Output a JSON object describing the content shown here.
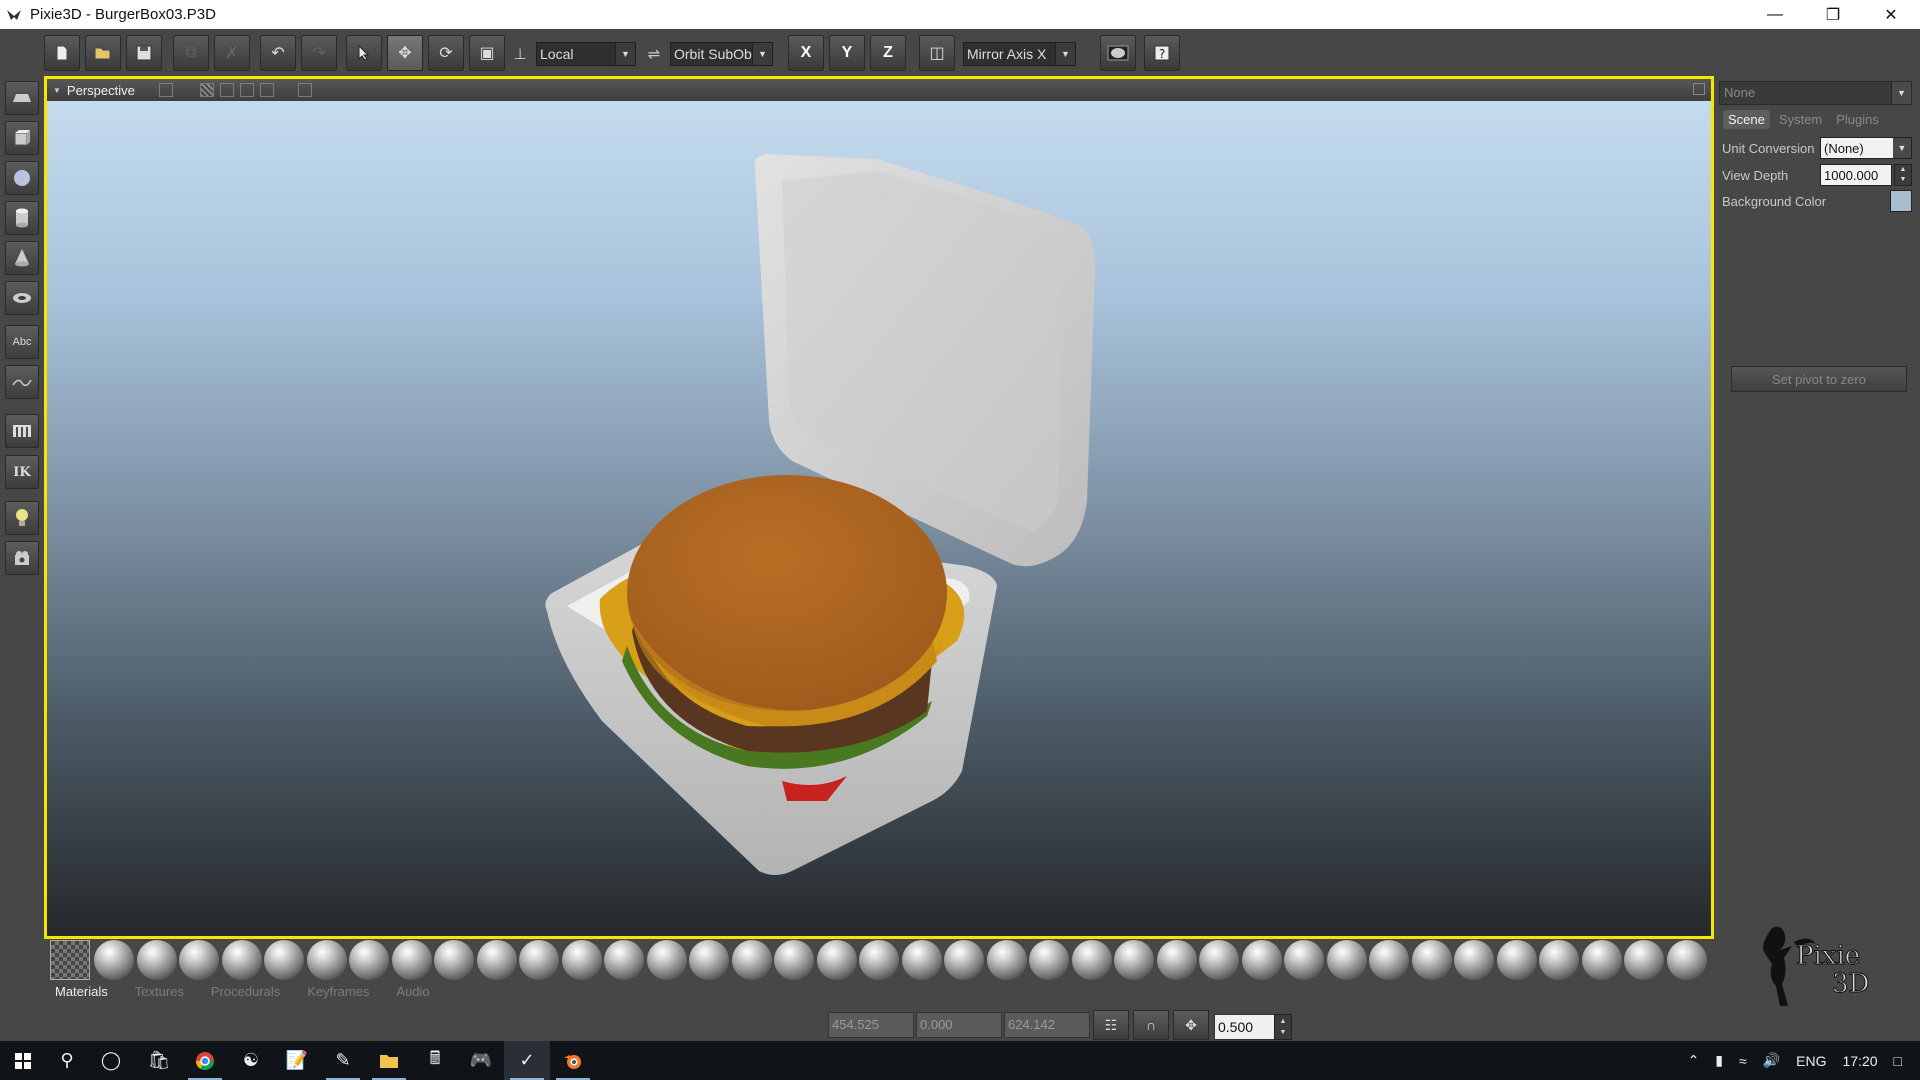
{
  "window": {
    "title": "Pixie3D - BurgerBox03.P3D",
    "controls": [
      "minimize-icon",
      "restore-icon",
      "close-icon"
    ]
  },
  "toolbar": {
    "coord_space": "Local",
    "camera_mode": "Orbit SubOb",
    "axis_x": "X",
    "axis_y": "Y",
    "axis_z": "Z",
    "mirror_axis": "Mirror Axis X"
  },
  "leftbar": {
    "text_tool": "Abc",
    "ik_tool": "IK"
  },
  "viewport": {
    "title": "Perspective",
    "border_color": "#f5e600"
  },
  "right_panel": {
    "object_select": "None",
    "tabs": [
      "Scene",
      "System",
      "Plugins"
    ],
    "active_tab": "Scene",
    "unit_conversion_label": "Unit Conversion",
    "unit_conversion_value": "(None)",
    "view_depth_label": "View Depth",
    "view_depth_value": "1000.000",
    "background_color_label": "Background Color",
    "background_color": "#a9bcd0",
    "set_pivot_button": "Set pivot to zero",
    "logo_line1": "Pixie",
    "logo_line2": "3D"
  },
  "bottom_tabs": [
    "Materials",
    "Textures",
    "Procedurals",
    "Keyframes",
    "Audio"
  ],
  "coords": {
    "x": "454.525",
    "y": "0.000",
    "z": "624.142",
    "step": "0.500"
  },
  "taskbar": {
    "language": "ENG",
    "time": "17:20"
  }
}
